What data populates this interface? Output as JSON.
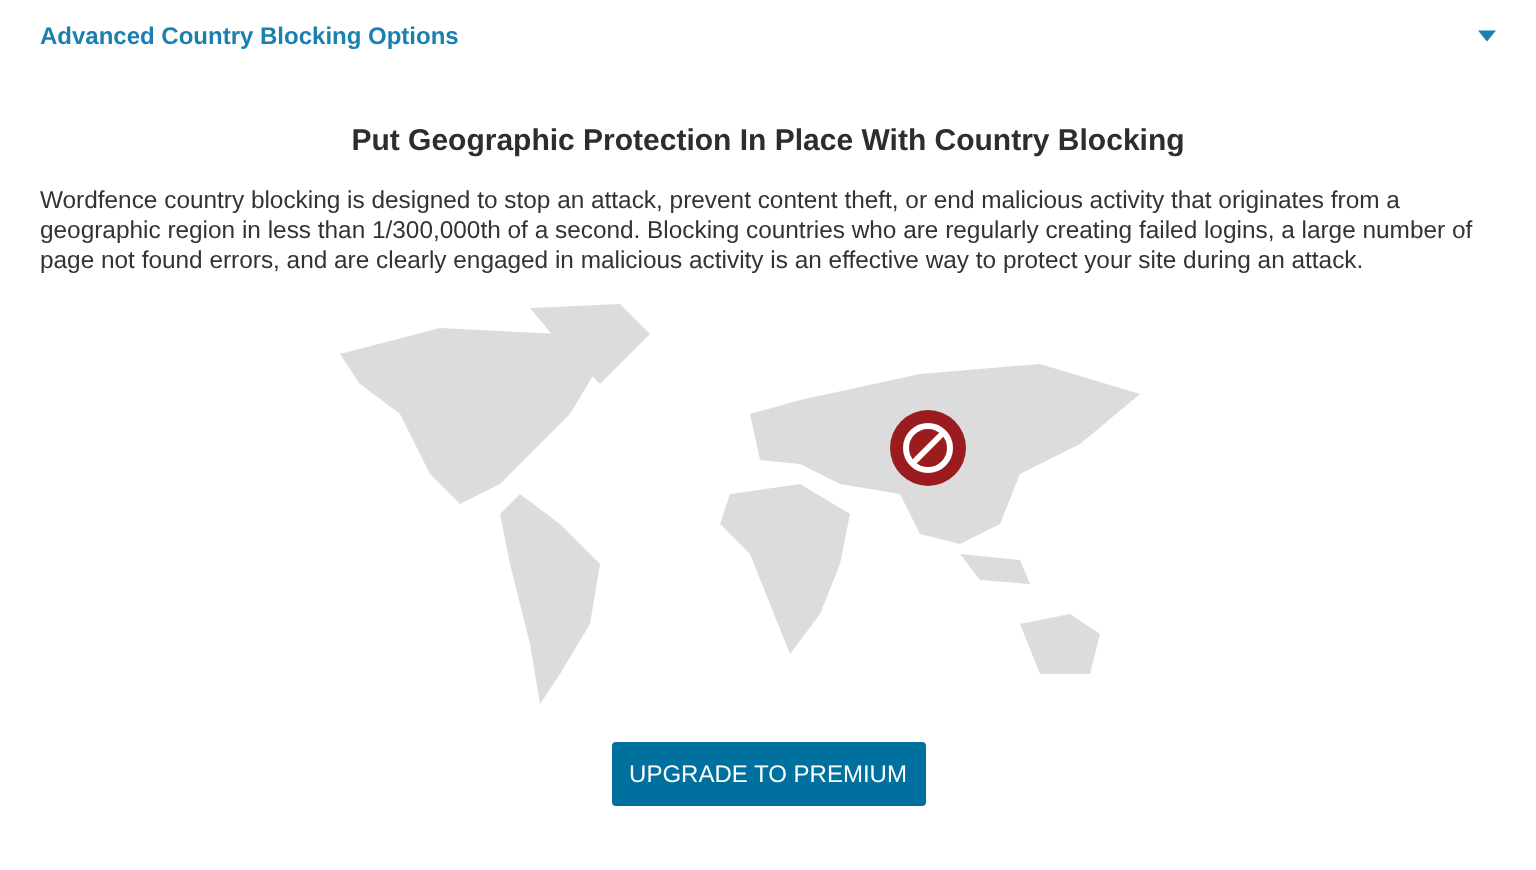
{
  "section": {
    "title": "Advanced Country Blocking Options",
    "expanded": true
  },
  "heading": "Put Geographic Protection In Place With Country Blocking",
  "description": "Wordfence country blocking is designed to stop an attack, prevent content theft, or end malicious activity that originates from a geographic region in less than 1/300,000th of a second. Blocking countries who are regularly creating failed logins, a large number of page not found errors, and are clearly engaged in malicious activity is an effective way to protect your site during an attack.",
  "upgrade_button": "UPGRADE TO PREMIUM"
}
